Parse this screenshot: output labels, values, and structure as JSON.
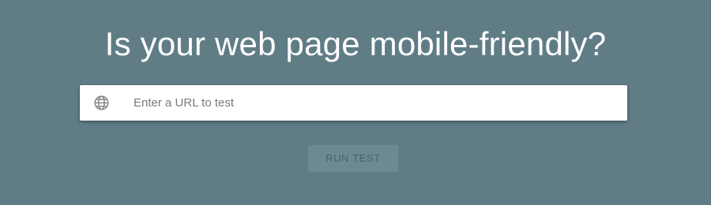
{
  "headline": "Is your web page mobile-friendly?",
  "url_field": {
    "placeholder": "Enter a URL to test",
    "value": "",
    "icon": "globe-icon"
  },
  "run_button": {
    "label": "RUN TEST",
    "state": "disabled"
  },
  "colors": {
    "background": "#607d86",
    "headline_text": "#ffffff",
    "input_background": "#ffffff",
    "icon": "#8a8a8a",
    "button_background": "#6d8a93",
    "button_text": "#4a636b"
  }
}
